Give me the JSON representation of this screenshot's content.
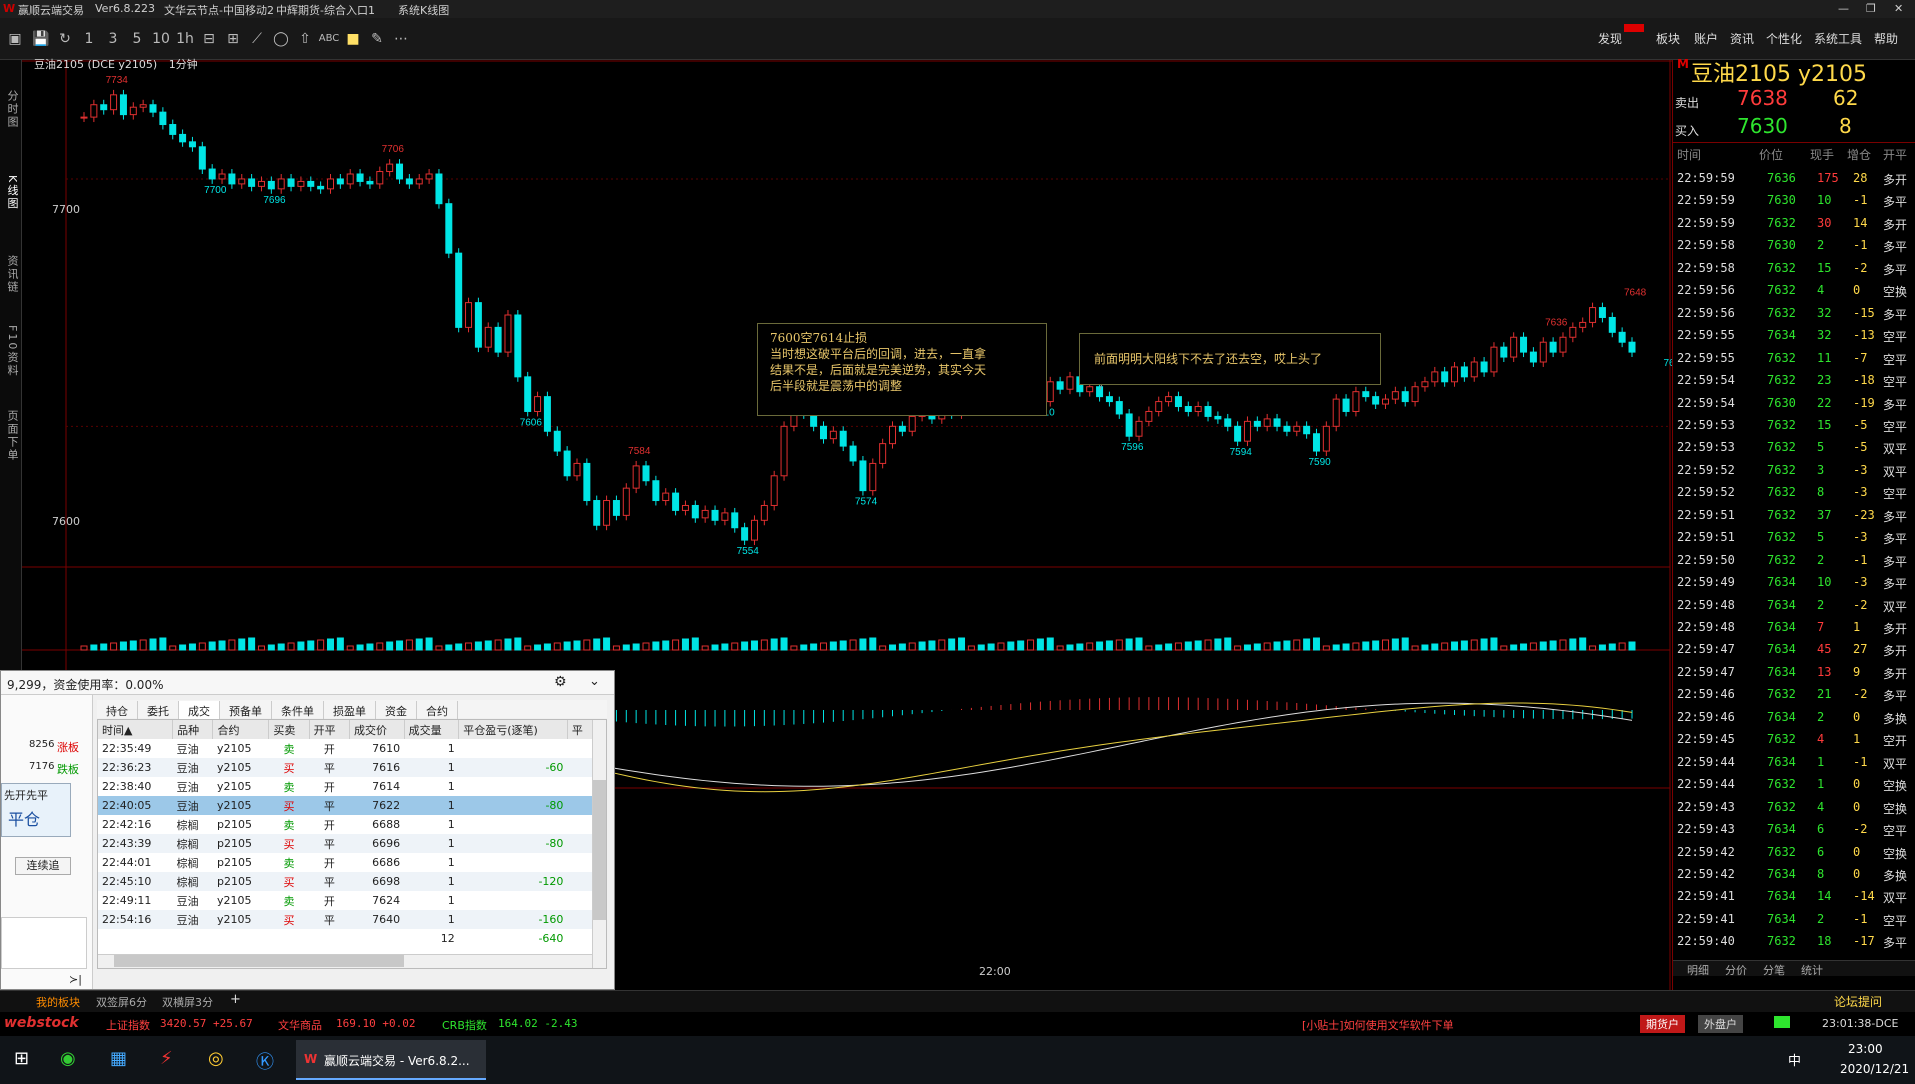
{
  "titlebar": {
    "app": "赢顺云端交易",
    "version": "Ver6.8.223",
    "node": "文华云节点-中国移动2",
    "broker": "中辉期货-综合入口1",
    "view": "系统K线图"
  },
  "menu": [
    "发现",
    "板块",
    "账户",
    "资讯",
    "个性化",
    "系统工具",
    "帮助"
  ],
  "left_tabs": [
    "分时图",
    "K线图",
    "资讯链",
    "F10资料",
    "页面下单"
  ],
  "chart": {
    "contract": "豆油2105",
    "exchange": "(DCE y2105)",
    "period": "1分钟",
    "y_labels": [
      "7700",
      "7600"
    ],
    "time_label": "22:00",
    "price_labels": [
      "7734",
      "7700",
      "7696",
      "7706",
      "7606",
      "7584",
      "7554",
      "7610",
      "7574",
      "7628",
      "7610",
      "7612",
      "7596",
      "7594",
      "7590",
      "7636",
      "7648",
      "7630"
    ],
    "note1": [
      "7600空7614止损",
      "当时想这破平台后的回调，进去，一直拿",
      "结果不是，后面就是完美逆势，其实今天",
      "后半段就是震荡中的调整"
    ],
    "note2": "前面明明大阳线下不去了还去空，哎上头了"
  },
  "chart_data": {
    "type": "candlestick",
    "contract": "豆油2105",
    "period": "1分钟",
    "ylim": [
      7550,
      7740
    ],
    "close": [
      7725,
      7730,
      7728,
      7734,
      7726,
      7729,
      7730,
      7727,
      7722,
      7718,
      7715,
      7713,
      7704,
      7700,
      7702,
      7698,
      7700,
      7697,
      7699,
      7696,
      7700,
      7697,
      7699,
      7697,
      7696,
      7700,
      7698,
      7702,
      7699,
      7698,
      7703,
      7706,
      7700,
      7698,
      7700,
      7702,
      7690,
      7670,
      7640,
      7650,
      7632,
      7640,
      7630,
      7645,
      7620,
      7606,
      7612,
      7598,
      7590,
      7580,
      7585,
      7570,
      7560,
      7570,
      7564,
      7575,
      7584,
      7578,
      7570,
      7573,
      7566,
      7568,
      7563,
      7566,
      7562,
      7565,
      7559,
      7554,
      7562,
      7568,
      7580,
      7600,
      7610,
      7605,
      7600,
      7595,
      7598,
      7592,
      7586,
      7574,
      7585,
      7593,
      7600,
      7598,
      7604,
      7607,
      7603,
      7608,
      7605,
      7618,
      7622,
      7626,
      7628,
      7624,
      7618,
      7620,
      7616,
      7610,
      7618,
      7615,
      7620,
      7614,
      7616,
      7612,
      7610,
      7605,
      7596,
      7602,
      7606,
      7610,
      7612,
      7608,
      7606,
      7608,
      7604,
      7603,
      7600,
      7594,
      7602,
      7600,
      7603,
      7600,
      7598,
      7600,
      7597,
      7590,
      7600,
      7611,
      7606,
      7614,
      7612,
      7609,
      7611,
      7614,
      7610,
      7616,
      7618,
      7622,
      7618,
      7624,
      7620,
      7626,
      7622,
      7632,
      7628,
      7636,
      7630,
      7626,
      7634,
      7630,
      7636,
      7640,
      7642,
      7648,
      7644,
      7638,
      7634,
      7630
    ]
  },
  "right": {
    "title": "豆油2105  y2105",
    "sell_label": "卖出",
    "sell_price": "7638",
    "sell_vol": "62",
    "buy_label": "买入",
    "buy_price": "7630",
    "buy_vol": "8",
    "cols": [
      "时间",
      "价位",
      "现手",
      "增仓",
      "开平"
    ],
    "ticks": [
      [
        "22:59:59",
        "7636",
        "175",
        "28",
        "多开"
      ],
      [
        "22:59:59",
        "7630",
        "10",
        "-1",
        "多平"
      ],
      [
        "22:59:59",
        "7632",
        "30",
        "14",
        "多开"
      ],
      [
        "22:59:58",
        "7630",
        "2",
        "-1",
        "多平"
      ],
      [
        "22:59:58",
        "7632",
        "15",
        "-2",
        "多平"
      ],
      [
        "22:59:56",
        "7632",
        "4",
        "0",
        "空换"
      ],
      [
        "22:59:56",
        "7632",
        "32",
        "-15",
        "多平"
      ],
      [
        "22:59:55",
        "7634",
        "32",
        "-13",
        "空平"
      ],
      [
        "22:59:55",
        "7632",
        "11",
        "-7",
        "空平"
      ],
      [
        "22:59:54",
        "7632",
        "23",
        "-18",
        "空平"
      ],
      [
        "22:59:54",
        "7630",
        "22",
        "-19",
        "多平"
      ],
      [
        "22:59:53",
        "7632",
        "15",
        "-5",
        "空平"
      ],
      [
        "22:59:53",
        "7632",
        "5",
        "-5",
        "双平"
      ],
      [
        "22:59:52",
        "7632",
        "3",
        "-3",
        "双平"
      ],
      [
        "22:59:52",
        "7632",
        "8",
        "-3",
        "空平"
      ],
      [
        "22:59:51",
        "7632",
        "37",
        "-23",
        "多平"
      ],
      [
        "22:59:51",
        "7632",
        "5",
        "-3",
        "多平"
      ],
      [
        "22:59:50",
        "7632",
        "2",
        "-1",
        "多平"
      ],
      [
        "22:59:49",
        "7634",
        "10",
        "-3",
        "多平"
      ],
      [
        "22:59:48",
        "7634",
        "2",
        "-2",
        "双平"
      ],
      [
        "22:59:48",
        "7634",
        "7",
        "1",
        "多开"
      ],
      [
        "22:59:47",
        "7634",
        "45",
        "27",
        "多开"
      ],
      [
        "22:59:47",
        "7634",
        "13",
        "9",
        "多开"
      ],
      [
        "22:59:46",
        "7632",
        "21",
        "-2",
        "多平"
      ],
      [
        "22:59:46",
        "7634",
        "2",
        "0",
        "多换"
      ],
      [
        "22:59:45",
        "7632",
        "4",
        "1",
        "空开"
      ],
      [
        "22:59:44",
        "7634",
        "1",
        "-1",
        "双平"
      ],
      [
        "22:59:44",
        "7632",
        "1",
        "0",
        "空换"
      ],
      [
        "22:59:43",
        "7632",
        "4",
        "0",
        "空换"
      ],
      [
        "22:59:43",
        "7634",
        "6",
        "-2",
        "空平"
      ],
      [
        "22:59:42",
        "7632",
        "6",
        "0",
        "空换"
      ],
      [
        "22:59:42",
        "7634",
        "8",
        "0",
        "多换"
      ],
      [
        "22:59:41",
        "7634",
        "14",
        "-14",
        "双平"
      ],
      [
        "22:59:41",
        "7634",
        "2",
        "-1",
        "空平"
      ],
      [
        "22:59:40",
        "7632",
        "18",
        "-17",
        "多平"
      ]
    ],
    "tabs": [
      "明细",
      "分价",
      "分笔",
      "统计"
    ],
    "forum": "论坛提问"
  },
  "panel": {
    "header": "9,299，资金使用率：0.00%",
    "limit_up": "8256",
    "limit_up_label": "涨板",
    "limit_down": "7176",
    "limit_down_label": "跌板",
    "mode": "先开先平",
    "close_btn": "平仓",
    "chase": "连续追",
    "tabs": [
      "持仓",
      "委托",
      "成交",
      "预备单",
      "条件单",
      "损盈单",
      "资金",
      "合约"
    ],
    "cols": [
      "时间▲",
      "品种",
      "合约",
      "买卖",
      "开平",
      "成交价",
      "成交量",
      "平仓盈亏(逐笔)",
      "平"
    ],
    "rows": [
      [
        "22:35:49",
        "豆油",
        "y2105",
        "卖",
        "开",
        "7610",
        "1",
        ""
      ],
      [
        "22:36:23",
        "豆油",
        "y2105",
        "买",
        "平",
        "7616",
        "1",
        "-60"
      ],
      [
        "22:38:40",
        "豆油",
        "y2105",
        "卖",
        "开",
        "7614",
        "1",
        ""
      ],
      [
        "22:40:05",
        "豆油",
        "y2105",
        "买",
        "平",
        "7622",
        "1",
        "-80"
      ],
      [
        "22:42:16",
        "棕榈",
        "p2105",
        "卖",
        "开",
        "6688",
        "1",
        ""
      ],
      [
        "22:43:39",
        "棕榈",
        "p2105",
        "买",
        "平",
        "6696",
        "1",
        "-80"
      ],
      [
        "22:44:01",
        "棕榈",
        "p2105",
        "卖",
        "开",
        "6686",
        "1",
        ""
      ],
      [
        "22:45:10",
        "棕榈",
        "p2105",
        "买",
        "平",
        "6698",
        "1",
        "-120"
      ],
      [
        "22:49:11",
        "豆油",
        "y2105",
        "卖",
        "开",
        "7624",
        "1",
        ""
      ],
      [
        "22:54:16",
        "豆油",
        "y2105",
        "买",
        "平",
        "7640",
        "1",
        "-160"
      ],
      [
        "",
        "",
        "",
        "",
        "",
        "",
        "12",
        "-640"
      ]
    ]
  },
  "bottom": {
    "tabs": [
      "我的板块",
      "双签屏6分",
      "双横屏3分",
      "+"
    ]
  },
  "status": {
    "brand": "webstock",
    "idx1": "上证指数",
    "idx1_val": "3420.57 +25.67",
    "idx2": "文华商品",
    "idx2_val": "169.10 +0.02",
    "idx3": "CRB指数",
    "idx3_val": "164.02 -2.43",
    "tip": "[小贴士]如何使用文华软件下单",
    "btn1": "期货户",
    "btn2": "外盘户",
    "clock": "23:01:38-DCE"
  },
  "taskbar": {
    "app": "赢顺云端交易 - Ver6.8.2...",
    "time": "23:00",
    "date": "2020/12/21",
    "ime": "中"
  }
}
